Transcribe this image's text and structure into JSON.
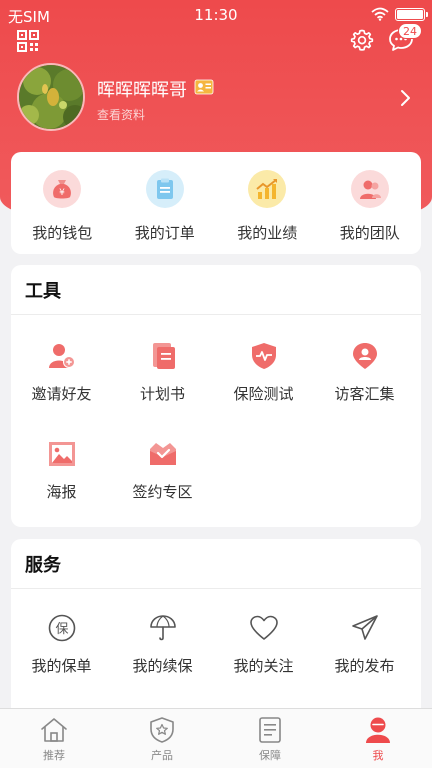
{
  "status_bar": {
    "carrier": "无SIM",
    "time": "11:30"
  },
  "header": {
    "username": "晖晖晖晖哥",
    "view_profile": "查看资料",
    "message_count": "24"
  },
  "quick_actions": [
    {
      "label": "我的钱包",
      "icon": "wallet-icon"
    },
    {
      "label": "我的订单",
      "icon": "order-icon"
    },
    {
      "label": "我的业绩",
      "icon": "performance-chart-icon"
    },
    {
      "label": "我的团队",
      "icon": "team-icon"
    }
  ],
  "tools": {
    "title": "工具",
    "items": [
      {
        "label": "邀请好友",
        "icon": "invite-friend-icon"
      },
      {
        "label": "计划书",
        "icon": "plan-document-icon"
      },
      {
        "label": "保险测试",
        "icon": "insurance-test-icon"
      },
      {
        "label": "访客汇集",
        "icon": "visitor-location-icon"
      },
      {
        "label": "海报",
        "icon": "poster-icon"
      },
      {
        "label": "签约专区",
        "icon": "contract-crown-icon"
      }
    ]
  },
  "services": {
    "title": "服务",
    "items": [
      {
        "label": "我的保单",
        "icon": "policy-icon"
      },
      {
        "label": "我的续保",
        "icon": "umbrella-icon"
      },
      {
        "label": "我的关注",
        "icon": "heart-icon"
      },
      {
        "label": "我的发布",
        "icon": "send-icon"
      }
    ]
  },
  "tabbar": [
    {
      "label": "推荐",
      "icon": "home-icon",
      "active": false
    },
    {
      "label": "产品",
      "icon": "product-icon",
      "active": false
    },
    {
      "label": "保障",
      "icon": "coverage-icon",
      "active": false
    },
    {
      "label": "我",
      "icon": "profile-icon",
      "active": true
    }
  ],
  "colors": {
    "accent": "#ee4a4c",
    "background": "#f2f2f4"
  }
}
